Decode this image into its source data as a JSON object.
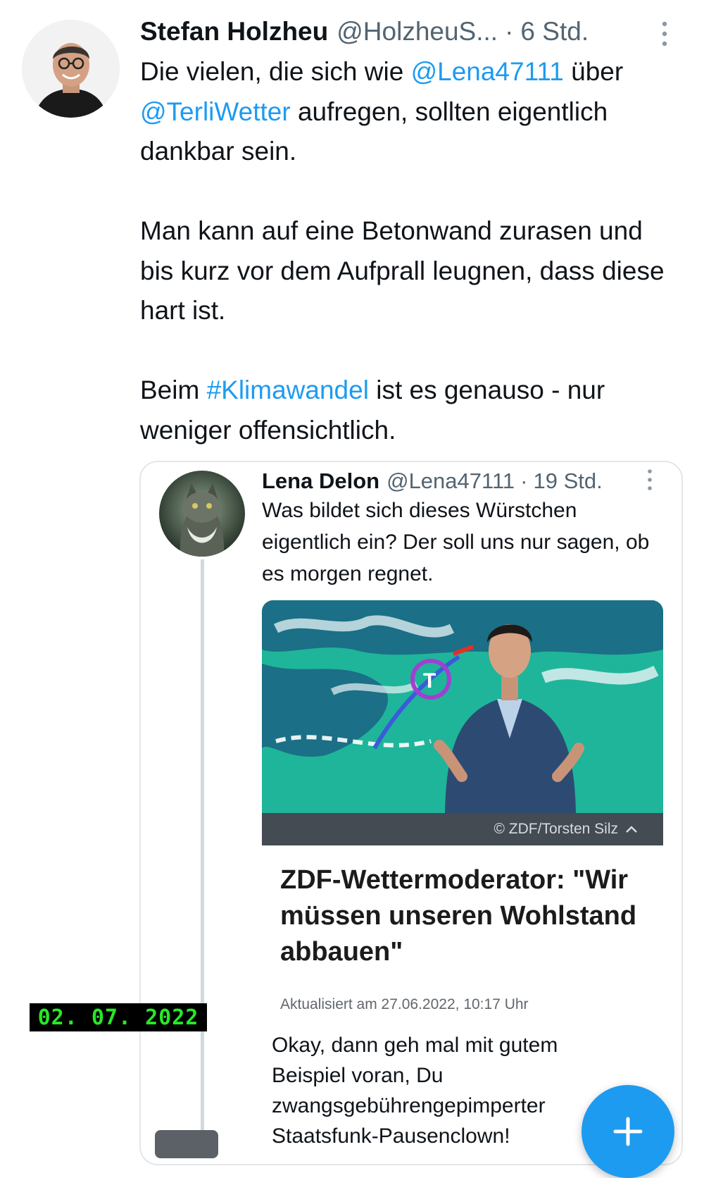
{
  "tweet": {
    "author_name": "Stefan Holzheu",
    "author_handle": "@HolzheuS...",
    "separator": "·",
    "time": "6 Std.",
    "text": {
      "p1_a": "Die vielen, die sich wie ",
      "p1_mention1": "@Lena47111",
      "p1_b": " über",
      "p1_mention2": "@TerliWetter",
      "p1_c": " aufregen, sollten eigentlich dankbar sein.",
      "p2": "Man kann auf eine Betonwand zurasen und bis kurz vor dem Aufprall leugnen, dass diese hart ist.",
      "p3_a": "Beim ",
      "p3_hashtag": "#Klimawandel",
      "p3_b": " ist es genauso - nur weniger offensichtlich."
    }
  },
  "quoted": {
    "author_name": "Lena Delon",
    "author_handle": "@Lena47111",
    "separator": "·",
    "time": "19 Std.",
    "text": "Was bildet sich dieses Würstchen eigentlich ein? Der soll uns nur sagen, ob es morgen regnet.",
    "article": {
      "image_caption": "© ZDF/Torsten Silz",
      "headline": "ZDF-Wettermoderator: \"Wir müssen unseren Wohlstand abbauen\"",
      "updated": "Aktualisiert am 27.06.2022, 10:17 Uhr"
    },
    "body": "Okay, dann geh mal mit gutem Beispiel voran, Du zwangsgebührengepimperter Staatsfunk-Pausenclown!"
  },
  "date_stamp": "02. 07. 2022",
  "colors": {
    "link": "#1d9bf0",
    "fab": "#1d9bf0",
    "stamp_text": "#27e827"
  },
  "icons": [
    "more-vertical-icon",
    "chevron-up-icon",
    "compose-plus-icon"
  ]
}
